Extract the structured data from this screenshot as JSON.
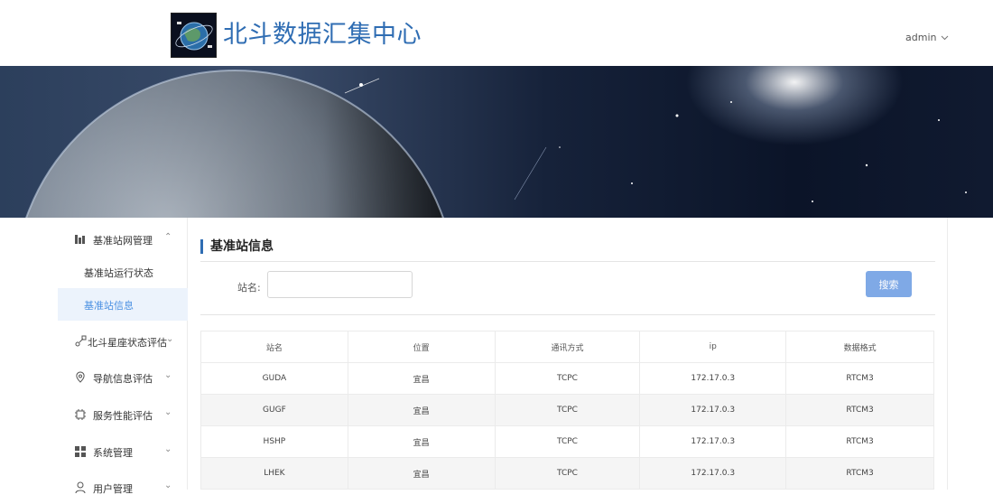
{
  "header": {
    "title": "北斗数据汇集中心",
    "user": "admin"
  },
  "sidebar": {
    "groups": [
      {
        "label": "基准站网管理",
        "icon": "chart-icon",
        "expanded": true,
        "items": [
          {
            "label": "基准站运行状态",
            "active": false
          },
          {
            "label": "基准站信息",
            "active": true
          }
        ]
      },
      {
        "label": "北斗星座状态评估",
        "icon": "satellite-icon",
        "expanded": false
      },
      {
        "label": "导航信息评估",
        "icon": "location-icon",
        "expanded": false
      },
      {
        "label": "服务性能评估",
        "icon": "chip-icon",
        "expanded": false
      },
      {
        "label": "系统管理",
        "icon": "grid-icon",
        "expanded": false
      },
      {
        "label": "用户管理",
        "icon": "user-icon",
        "expanded": false
      }
    ]
  },
  "main": {
    "section_title": "基准站信息",
    "search": {
      "label": "站名:",
      "value": "",
      "placeholder": "",
      "button": "搜索"
    },
    "table": {
      "columns": [
        "站名",
        "位置",
        "通讯方式",
        "ip",
        "数据格式"
      ],
      "rows": [
        [
          "GUDA",
          "宜昌",
          "TCPC",
          "172.17.0.3",
          "RTCM3"
        ],
        [
          "GUGF",
          "宜昌",
          "TCPC",
          "172.17.0.3",
          "RTCM3"
        ],
        [
          "HSHP",
          "宜昌",
          "TCPC",
          "172.17.0.3",
          "RTCM3"
        ],
        [
          "LHEK",
          "宜昌",
          "TCPC",
          "172.17.0.3",
          "RTCM3"
        ]
      ]
    }
  },
  "colors": {
    "accent": "#2f6db3",
    "button": "#7fa9e6",
    "active_bg": "#ecf3fc",
    "active_text": "#4a90e2"
  }
}
